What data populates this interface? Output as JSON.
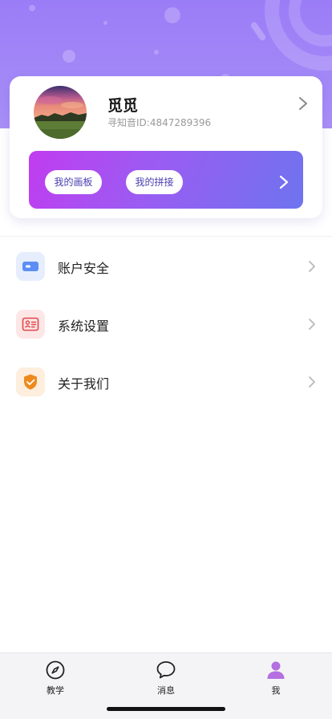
{
  "profile": {
    "name": "觅觅",
    "id_label": "寻知音ID:",
    "id_value": "4847289396",
    "avatar": "avatar-landscape-image"
  },
  "banner": {
    "buttons": [
      {
        "label": "我的画板"
      },
      {
        "label": "我的拼接"
      }
    ]
  },
  "menu": {
    "items": [
      {
        "label": "账户安全",
        "icon": "card-icon",
        "color": "#5b8ff5",
        "bg": "#e6eefe"
      },
      {
        "label": "系统设置",
        "icon": "id-card-icon",
        "color": "#e0474c",
        "bg": "#fde6e6"
      },
      {
        "label": "关于我们",
        "icon": "shield-check-icon",
        "color": "#ee8a1d",
        "bg": "#fdeedd"
      }
    ]
  },
  "tabbar": {
    "tabs": [
      {
        "label": "教学",
        "icon": "compass-icon",
        "active": false
      },
      {
        "label": "消息",
        "icon": "chat-bubble-icon",
        "active": false
      },
      {
        "label": "我",
        "icon": "person-icon",
        "active": true
      }
    ],
    "active_color": "#b46fe0"
  },
  "colors": {
    "header_purple": "#9b7cf7",
    "banner_gradient_start": "#c13cf0",
    "banner_gradient_end": "#6e74ef"
  }
}
